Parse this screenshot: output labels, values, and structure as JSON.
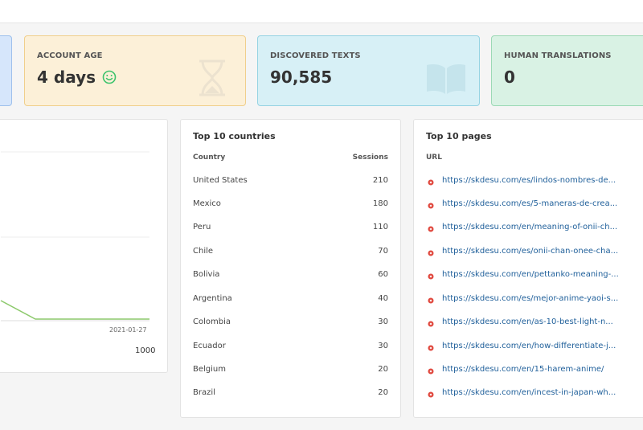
{
  "stats": {
    "account_age": {
      "label": "ACCOUNT AGE",
      "value": "4 days",
      "icon": "hourglass-icon",
      "color": "#fcf0d8"
    },
    "discovered_texts": {
      "label": "DISCOVERED TEXTS",
      "value": "90,585",
      "icon": "book-icon",
      "color": "#d7f0f6"
    },
    "human_translations": {
      "label": "HUMAN TRANSLATIONS",
      "value": "0",
      "color": "#d9f2e4"
    }
  },
  "chart": {
    "x_tick": "2021-01-27",
    "value_label": "1000",
    "line_color": "#8cc96b"
  },
  "countries": {
    "title": "Top 10 countries",
    "col_country": "Country",
    "col_sessions": "Sessions",
    "rows": [
      {
        "country": "United States",
        "sessions": "210"
      },
      {
        "country": "Mexico",
        "sessions": "180"
      },
      {
        "country": "Peru",
        "sessions": "110"
      },
      {
        "country": "Chile",
        "sessions": "70"
      },
      {
        "country": "Bolivia",
        "sessions": "60"
      },
      {
        "country": "Argentina",
        "sessions": "40"
      },
      {
        "country": "Colombia",
        "sessions": "30"
      },
      {
        "country": "Ecuador",
        "sessions": "30"
      },
      {
        "country": "Belgium",
        "sessions": "20"
      },
      {
        "country": "Brazil",
        "sessions": "20"
      }
    ]
  },
  "pages": {
    "title": "Top 10 pages",
    "col_url": "URL",
    "rows": [
      "https://skdesu.com/es/lindos-nombres-de...",
      "https://skdesu.com/es/5-maneras-de-crea...",
      "https://skdesu.com/en/meaning-of-onii-ch...",
      "https://skdesu.com/es/onii-chan-onee-cha...",
      "https://skdesu.com/en/pettanko-meaning-...",
      "https://skdesu.com/es/mejor-anime-yaoi-s...",
      "https://skdesu.com/en/as-10-best-light-n...",
      "https://skdesu.com/en/how-differentiate-j...",
      "https://skdesu.com/en/15-harem-anime/",
      "https://skdesu.com/en/incest-in-japan-wh..."
    ]
  }
}
